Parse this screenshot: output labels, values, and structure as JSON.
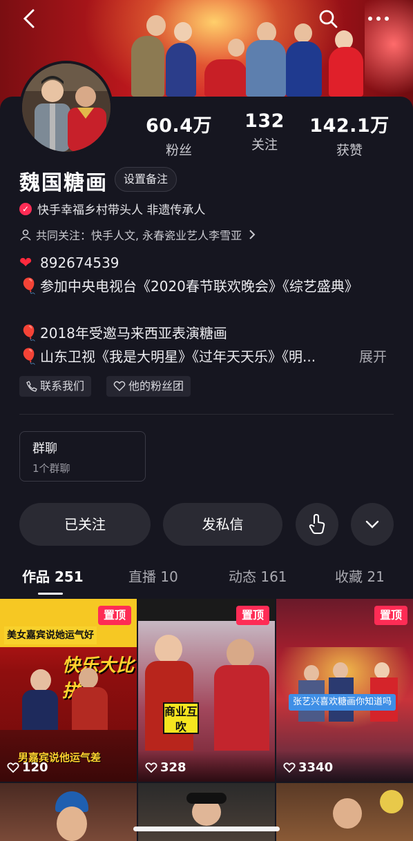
{
  "topbar": {
    "back_icon": "chevron-left-icon",
    "search_icon": "search-icon",
    "more_icon": "more-icon"
  },
  "profile": {
    "name": "魏国糖画",
    "remark_button": "设置备注",
    "verify_text": "快手幸福乡村带头人 非遗传承人",
    "mutual_text": "共同关注：快手人文, 永春瓷业艺人李雪亚",
    "stats": [
      {
        "value": "60.4万",
        "label": "粉丝"
      },
      {
        "value": "132",
        "label": "关注"
      },
      {
        "value": "142.1万",
        "label": "获赞"
      }
    ],
    "bio": [
      {
        "icon": "❤",
        "text": "892674539"
      },
      {
        "icon": "🎈",
        "text": "参加中央电视台《2020春节联欢晚会》《综艺盛典》"
      },
      {
        "icon": "🎈",
        "text": "2018年受邀马来西亚表演糖画"
      },
      {
        "icon": "🎈",
        "text": "山东卫视《我是大明星》《过年天天乐》《明..."
      }
    ],
    "expand": "展开",
    "chips": {
      "contact": "联系我们",
      "fans": "他的粉丝团"
    }
  },
  "group": {
    "title": "群聊",
    "subtitle": "1个群聊"
  },
  "actions": {
    "followed": "已关注",
    "message": "发私信"
  },
  "tabs": [
    {
      "label": "作品 251"
    },
    {
      "label": "直播 10"
    },
    {
      "label": "动态 161"
    },
    {
      "label": "收藏 21"
    }
  ],
  "videos": [
    {
      "pin": "置顶",
      "likes": "120",
      "caption_top": "美女嘉宾说她运气好",
      "caption_bottom": "男嘉宾说他运气差",
      "banner": "快乐大比拼"
    },
    {
      "pin": "置顶",
      "likes": "328",
      "sticker": "商业互吹"
    },
    {
      "pin": "置顶",
      "likes": "3340",
      "caption": "张艺兴喜欢糖画你知道吗"
    }
  ],
  "colors": {
    "accent": "#fe2c55",
    "background": "#161620",
    "card": "#2a2a33"
  }
}
